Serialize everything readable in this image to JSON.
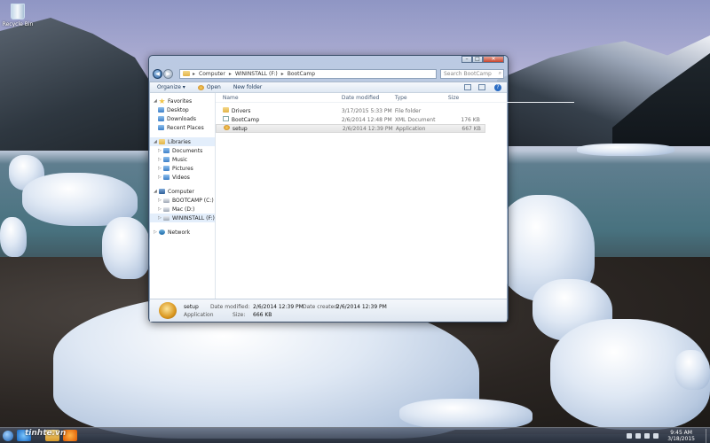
{
  "desktop": {
    "recycle_bin_label": "Recycle Bin"
  },
  "window": {
    "caption": {
      "minimize": "–",
      "maximize": "□",
      "close": "✕"
    },
    "breadcrumb": [
      "Computer",
      "WININSTALL (F:)",
      "BootCamp"
    ],
    "search_placeholder": "Search BootCamp",
    "toolbar": {
      "organize": "Organize ▾",
      "open": "Open",
      "new_folder": "New folder"
    },
    "columns": {
      "name": "Name",
      "date": "Date modified",
      "type": "Type",
      "size": "Size"
    },
    "files": [
      {
        "name": "Drivers",
        "date": "3/17/2015 5:33 PM",
        "type": "File folder",
        "size": "",
        "icon": "folder-icon"
      },
      {
        "name": "BootCamp",
        "date": "2/6/2014 12:48 PM",
        "type": "XML Document",
        "size": "176 KB",
        "icon": "xml-file-icon"
      },
      {
        "name": "setup",
        "date": "2/6/2014 12:39 PM",
        "type": "Application",
        "size": "667 KB",
        "icon": "setup-app-icon"
      }
    ],
    "nav": {
      "favorites": "Favorites",
      "desktop": "Desktop",
      "downloads": "Downloads",
      "recent": "Recent Places",
      "libraries": "Libraries",
      "documents": "Documents",
      "music": "Music",
      "pictures": "Pictures",
      "videos": "Videos",
      "computer": "Computer",
      "drive_c": "BOOTCAMP (C:)",
      "drive_d": "Mac (D:)",
      "drive_f": "WININSTALL (F:)",
      "network": "Network"
    },
    "status": {
      "name": "setup",
      "kind": "Application",
      "date_modified_label": "Date modified:",
      "date_modified": "2/6/2014 12:39 PM",
      "date_created_label": "Date created:",
      "date_created": "2/6/2014 12:39 PM",
      "size_label": "Size:",
      "size": "666 KB"
    }
  },
  "taskbar": {
    "watermark": "tinhte.vn",
    "time": "9:45 AM",
    "date": "3/18/2015"
  }
}
